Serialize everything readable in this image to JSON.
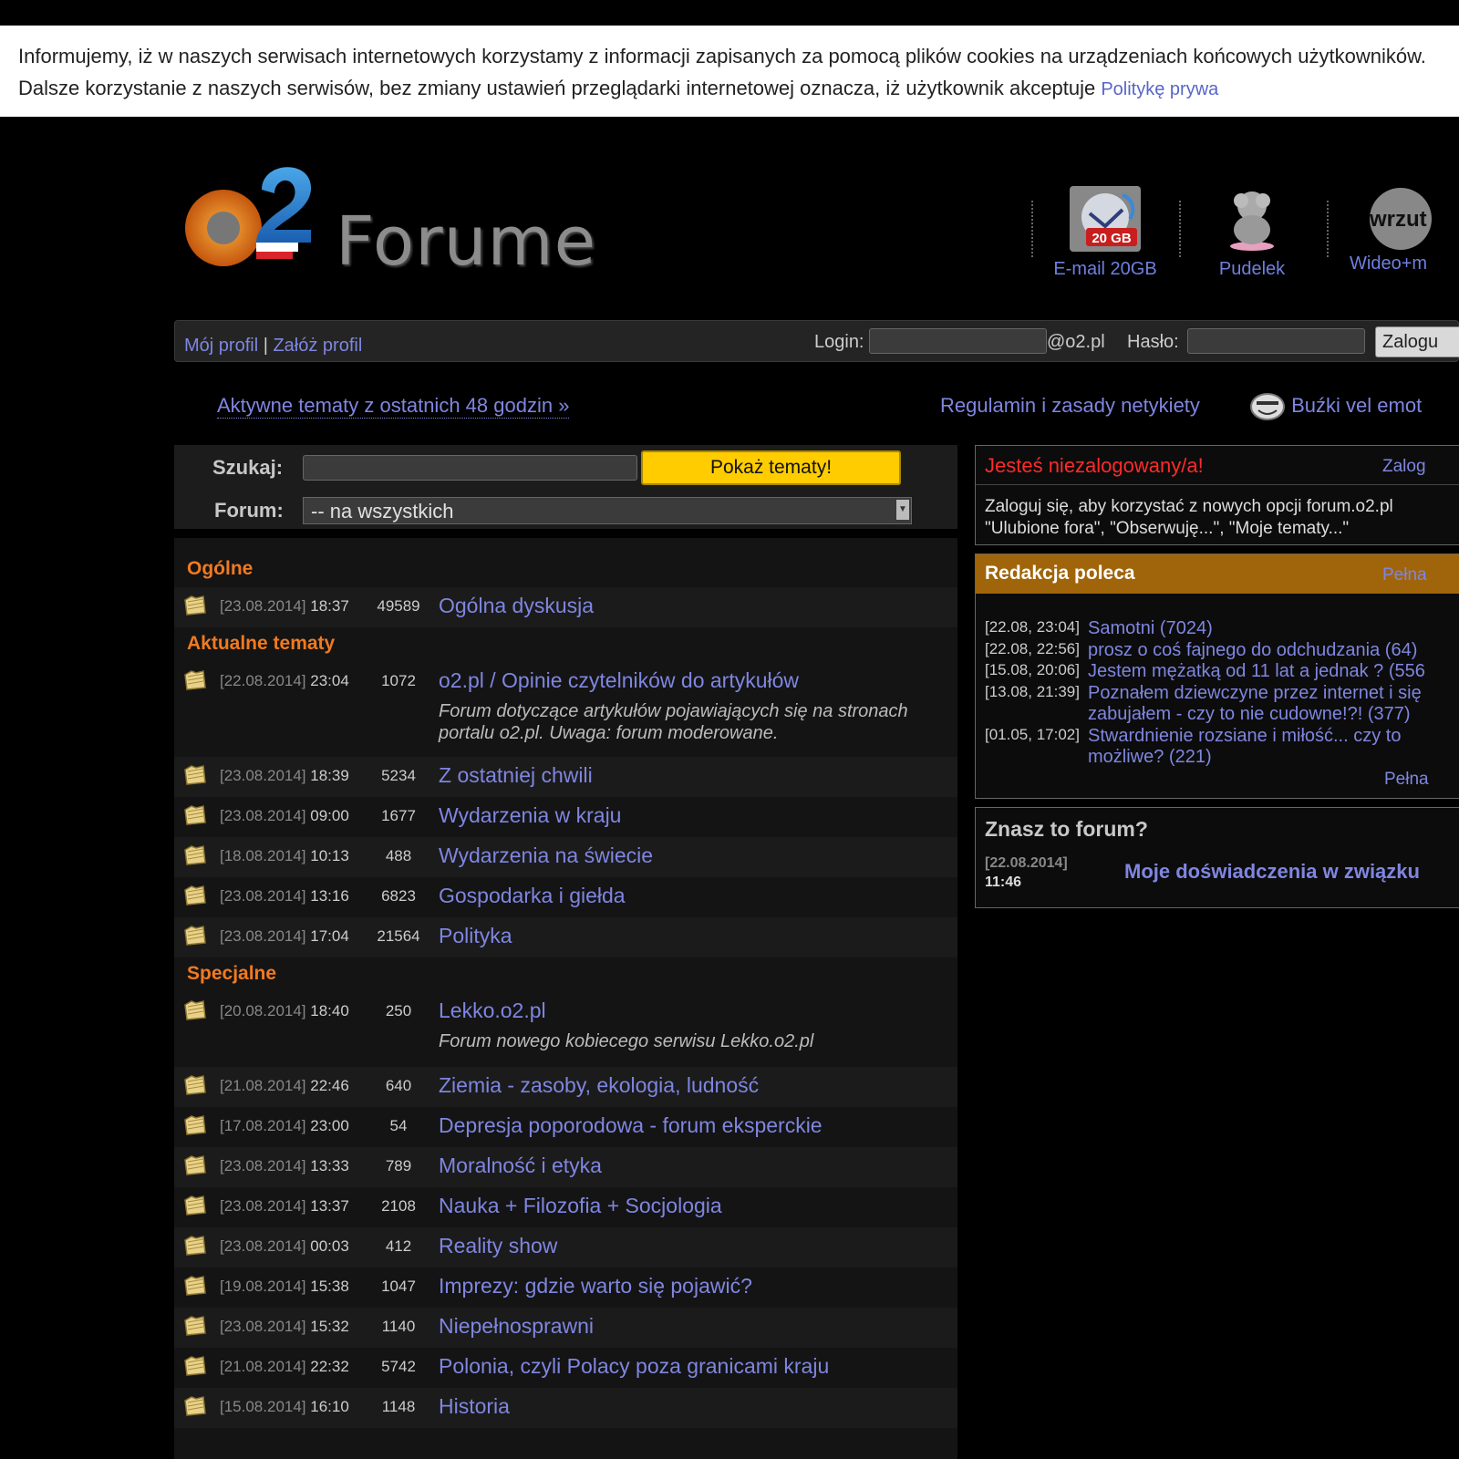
{
  "cookie": {
    "text": "Informujemy, iż w naszych serwisach internetowych korzystamy z informacji zapisanych za pomocą plików cookies na urządzeniach końcowych użytkowników. Dalsze korzystanie z naszych serwisów, bez zmiany ustawień przeglądarki internetowej oznacza, iż użytkownik akceptuje",
    "link": "Politykę prywa"
  },
  "header": {
    "logo_text": "Forume",
    "services": [
      {
        "label": "E-mail 20GB",
        "icon": "mail-20gb-icon",
        "badge": "20 GB"
      },
      {
        "label": "Pudelek",
        "icon": "pudelek-dog-icon"
      },
      {
        "label": "Wideo+m",
        "icon": "wrzuta-icon",
        "badge": "wrzut"
      }
    ]
  },
  "loginbar": {
    "my_profile": "Mój profil",
    "separator": "|",
    "create_profile": "Załóż profil",
    "login_label": "Login:",
    "domain": "@o2.pl",
    "password_label": "Hasło:",
    "login_button": "Zalogu"
  },
  "links": {
    "active": "Aktywne tematy z ostatnich 48 godzin »",
    "rules": "Regulamin i zasady netykiety",
    "emoticons": "Buźki vel emot"
  },
  "search": {
    "search_label": "Szukaj:",
    "forum_label": "Forum:",
    "button": "Pokaż tematy!",
    "select_value": "-- na wszystkich"
  },
  "categories": [
    {
      "name": "Ogólne",
      "forums": [
        {
          "date": "[23.08.2014]",
          "time": "18:37",
          "count": "49589",
          "name": "Ogólna dyskusja"
        }
      ]
    },
    {
      "name": "Aktualne tematy",
      "forums": [
        {
          "date": "[22.08.2014]",
          "time": "23:04",
          "count": "1072",
          "name": "o2.pl / Opinie czytelników do artykułów",
          "desc": "Forum dotyczące artykułów pojawiających się na stronach portalu o2.pl. Uwaga: forum moderowane."
        },
        {
          "date": "[23.08.2014]",
          "time": "18:39",
          "count": "5234",
          "name": "Z ostatniej chwili"
        },
        {
          "date": "[23.08.2014]",
          "time": "09:00",
          "count": "1677",
          "name": "Wydarzenia w kraju"
        },
        {
          "date": "[18.08.2014]",
          "time": "10:13",
          "count": "488",
          "name": "Wydarzenia na świecie"
        },
        {
          "date": "[23.08.2014]",
          "time": "13:16",
          "count": "6823",
          "name": "Gospodarka i giełda"
        },
        {
          "date": "[23.08.2014]",
          "time": "17:04",
          "count": "21564",
          "name": "Polityka"
        }
      ]
    },
    {
      "name": "Specjalne",
      "forums": [
        {
          "date": "[20.08.2014]",
          "time": "18:40",
          "count": "250",
          "name": "Lekko.o2.pl",
          "desc": "Forum nowego kobiecego serwisu Lekko.o2.pl"
        },
        {
          "date": "[21.08.2014]",
          "time": "22:46",
          "count": "640",
          "name": "Ziemia - zasoby, ekologia, ludność"
        },
        {
          "date": "[17.08.2014]",
          "time": "23:00",
          "count": "54",
          "name": "Depresja poporodowa - forum eksperckie"
        },
        {
          "date": "[23.08.2014]",
          "time": "13:33",
          "count": "789",
          "name": "Moralność i etyka"
        },
        {
          "date": "[23.08.2014]",
          "time": "13:37",
          "count": "2108",
          "name": "Nauka + Filozofia + Socjologia"
        },
        {
          "date": "[23.08.2014]",
          "time": "00:03",
          "count": "412",
          "name": "Reality show"
        },
        {
          "date": "[19.08.2014]",
          "time": "15:38",
          "count": "1047",
          "name": "Imprezy: gdzie warto się pojawić?"
        },
        {
          "date": "[23.08.2014]",
          "time": "15:32",
          "count": "1140",
          "name": "Niepełnosprawni"
        },
        {
          "date": "[21.08.2014]",
          "time": "22:32",
          "count": "5742",
          "name": "Polonia, czyli Polacy poza granicami kraju"
        },
        {
          "date": "[15.08.2014]",
          "time": "16:10",
          "count": "1148",
          "name": "Historia"
        }
      ]
    }
  ],
  "notlogged": {
    "title": "Jesteś niezalogowany/a!",
    "link": "Zalog",
    "line1": "Zaloguj się, aby korzystać z nowych opcji forum.o2.pl",
    "line2": "\"Ulubione fora\", \"Obserwuję...\", \"Moje tematy...\""
  },
  "recommended": {
    "title": "Redakcja poleca",
    "link": "Pełna",
    "footer_link": "Pełna",
    "items": [
      {
        "date": "[22.08, 23:04]",
        "lines": [
          "Samotni (7024)"
        ]
      },
      {
        "date": "[22.08, 22:56]",
        "lines": [
          "prosz o coś fajnego do odchudzania (64)"
        ]
      },
      {
        "date": "[15.08, 20:06]",
        "lines": [
          "Jestem mężatką od 11 lat a jednak ? (556"
        ]
      },
      {
        "date": "[13.08, 21:39]",
        "lines": [
          "Poznałem dziewczyne przez internet i się",
          "zabujałem - czy to nie cudowne!?! (377)"
        ]
      },
      {
        "date": "[01.05, 17:02]",
        "lines": [
          "Stwardnienie rozsiane i miłość... czy to",
          "możliwe? (221)"
        ]
      }
    ]
  },
  "knowforum": {
    "title": "Znasz to forum?",
    "date": "[22.08.2014]",
    "time": "11:46",
    "topic": "Moje doświadczenia w związku"
  },
  "colors": {
    "accent_link": "#7f86e0",
    "category": "#f07a20",
    "button_yellow": "#ffcc00",
    "recommended_header": "#a0650a",
    "notlogged_red": "#ff2a2a"
  }
}
